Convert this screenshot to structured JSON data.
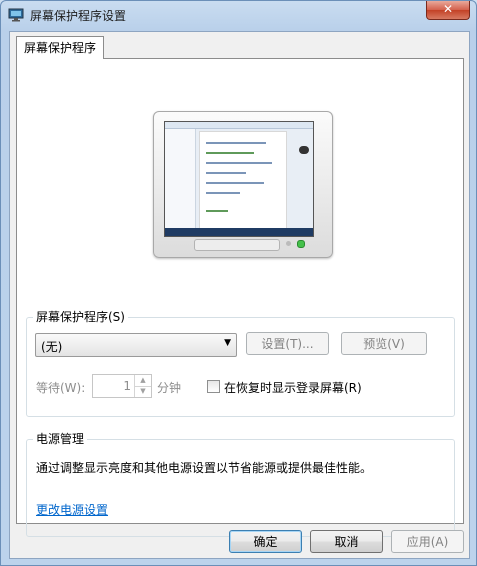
{
  "window": {
    "title": "屏幕保护程序设置",
    "close_label": "✕"
  },
  "tab": {
    "label": "屏幕保护程序"
  },
  "screensaver_group": {
    "legend": "屏幕保护程序(S)",
    "selected": "(无)",
    "settings_button": "设置(T)...",
    "preview_button": "预览(V)",
    "wait_label": "等待(W):",
    "wait_value": "1",
    "wait_unit": "分钟",
    "resume_checkbox_label": "在恢复时显示登录屏幕(R)",
    "resume_checked": false
  },
  "power_group": {
    "legend": "电源管理",
    "description": "通过调整显示亮度和其他电源设置以节省能源或提供最佳性能。",
    "link": "更改电源设置"
  },
  "footer": {
    "ok": "确定",
    "cancel": "取消",
    "apply": "应用(A)"
  },
  "colors": {
    "link": "#0066cc",
    "titlebar": "#c9dcf0",
    "close_button": "#c34126"
  }
}
